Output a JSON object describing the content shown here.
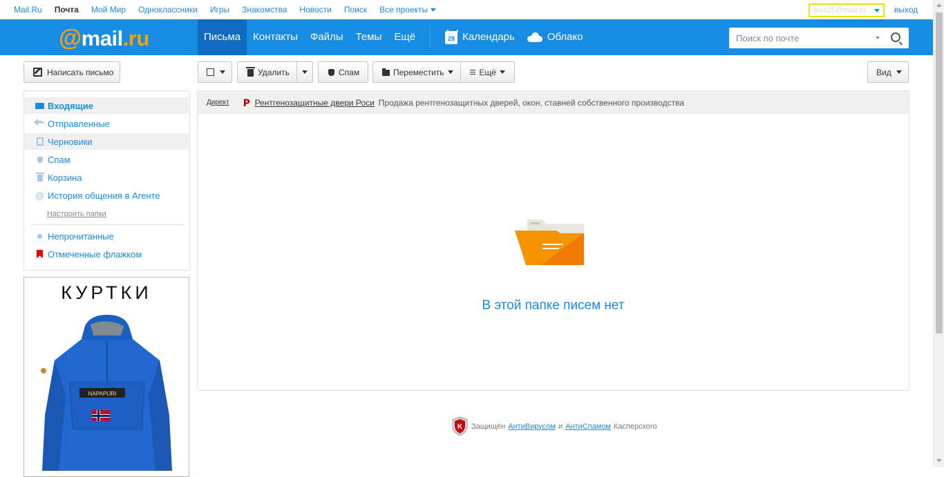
{
  "portal": {
    "links": [
      "Mail.Ru",
      "Почта",
      "Мой Мир",
      "Одноклассники",
      "Игры",
      "Знакомства",
      "Новости",
      "Поиск",
      "Все проекты"
    ],
    "active_link": "Почта",
    "account": "lexx25@mail.ru",
    "logout": "выход"
  },
  "header": {
    "logo": {
      "at": "@",
      "name": "mail",
      "dot": ".ru"
    },
    "nav": [
      "Письма",
      "Контакты",
      "Файлы",
      "Темы",
      "Ещё"
    ],
    "active_nav": "Письма",
    "calendar": {
      "label": "Календарь",
      "day": "28"
    },
    "cloud": "Облако",
    "search_placeholder": "Поиск по почте"
  },
  "toolbar": {
    "compose": "Написать письмо",
    "delete": "Удалить",
    "spam": "Спам",
    "move": "Переместить",
    "more": "Ещё",
    "view": "Вид"
  },
  "sidebar": {
    "folders": [
      {
        "label": "Входящие",
        "icon": "envelope-icon"
      },
      {
        "label": "Отправленные",
        "icon": "reply-icon"
      },
      {
        "label": "Черновики",
        "icon": "draft-icon"
      },
      {
        "label": "Спам",
        "icon": "thumbs-down-icon"
      },
      {
        "label": "Корзина",
        "icon": "trash-icon"
      },
      {
        "label": "История общения в Агенте",
        "icon": "at-icon"
      }
    ],
    "configure": "Настроить папки",
    "filters": [
      {
        "label": "Непрочитанные",
        "icon": "dot-icon"
      },
      {
        "label": "Отмеченные флажком",
        "icon": "flag-icon"
      }
    ]
  },
  "banner": {
    "title": "КУРТКИ"
  },
  "direct": {
    "tag": "Директ",
    "link": "Рентгенозащитные двери Роси",
    "text": "Продажа рентгенозащитных дверей, окон, ставней собственного производства"
  },
  "empty_message": "В этой папке писем нет",
  "footer": {
    "prefix": "Защищён",
    "antivirus": "АнтиВирусом",
    "and": "и",
    "antispam": "АнтиСпамом",
    "suffix": "Касперского"
  },
  "colors": {
    "brand_blue": "#168de2",
    "active_nav": "#0f6bbf",
    "logo_orange": "#ff9e00",
    "folder_orange": "#f59300"
  }
}
